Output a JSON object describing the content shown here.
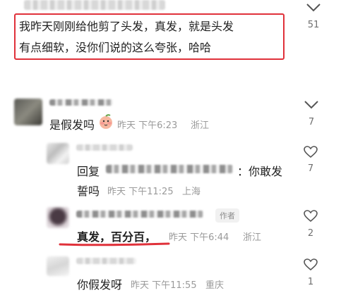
{
  "comment_main": {
    "line1": "我昨天刚刚给他剪了头发，真发，就是头发",
    "line2": "有点细软，没你们说的这么夸张，哈哈",
    "like_count": "51"
  },
  "comment_2": {
    "text": "是假发吗",
    "emoji": "peach-face-emoji",
    "time": "昨天 下午6:23",
    "location": "浙江",
    "like_count": "7"
  },
  "reply_1": {
    "prefix": "回复",
    "suffix": "：你敢发",
    "line2": "誓吗",
    "time": "昨天 下午11:25",
    "location": "上海",
    "like_count": "7"
  },
  "reply_2": {
    "author_tag": "作者",
    "text": "真发，百分百，",
    "time": "昨天 下午6:44",
    "location": "浙江",
    "like_count": "2"
  },
  "reply_3": {
    "text": "你假发呀",
    "time": "昨天 下午11:55",
    "location": "重庆",
    "like_count": "1"
  },
  "colors": {
    "highlight_red": "#e0313a",
    "meta_gray": "#9a9a9a"
  }
}
